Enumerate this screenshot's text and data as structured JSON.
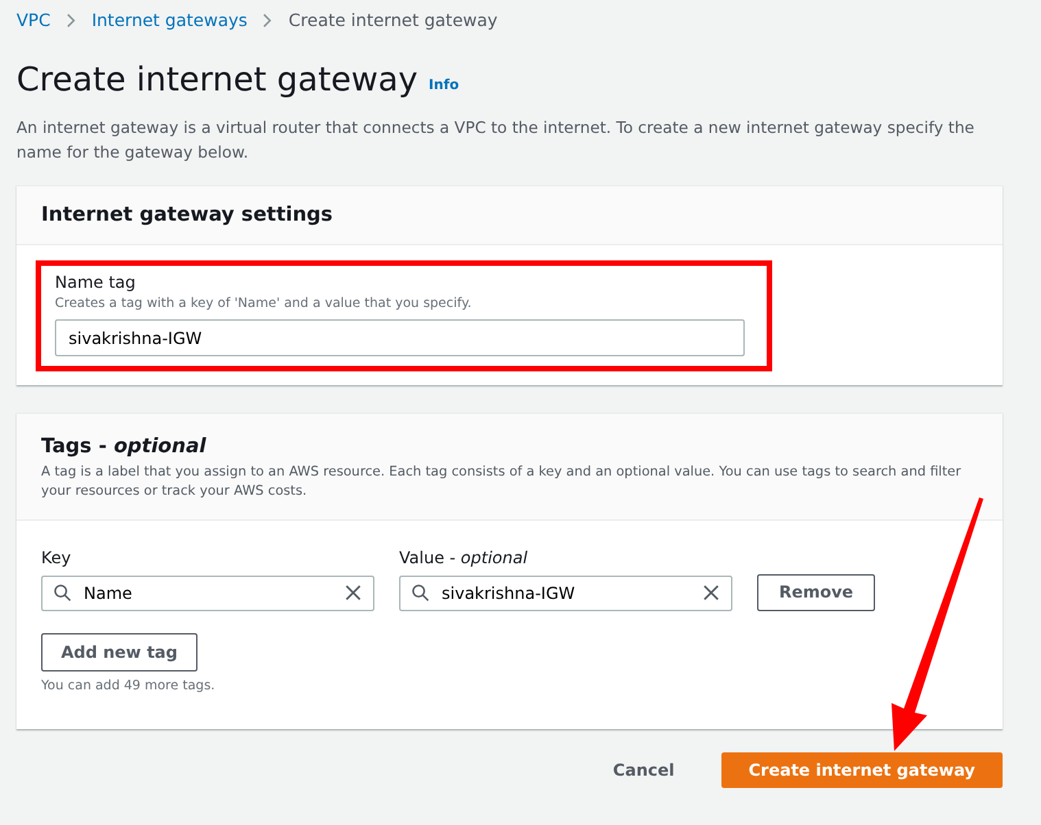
{
  "breadcrumb": [
    {
      "label": "VPC",
      "kind": "link"
    },
    {
      "label": "Internet gateways",
      "kind": "link"
    },
    {
      "label": "Create internet gateway",
      "kind": "current"
    }
  ],
  "title": "Create internet gateway",
  "info_link": "Info",
  "description": "An internet gateway is a virtual router that connects a VPC to the internet. To create a new internet gateway specify the name for the gateway below.",
  "settings": {
    "title": "Internet gateway settings",
    "name_tag": {
      "label": "Name tag",
      "hint": "Creates a tag with a key of 'Name' and a value that you specify.",
      "value": "sivakrishna-IGW"
    }
  },
  "tags": {
    "title": "Tags - ",
    "title_suffix": "optional",
    "description": "A tag is a label that you assign to an AWS resource. Each tag consists of a key and an optional value. You can use tags to search and filter your resources or track your AWS costs.",
    "key_label": "Key",
    "value_label": "Value - ",
    "value_label_suffix": "optional",
    "rows": [
      {
        "key": "Name",
        "value": "sivakrishna-IGW",
        "remove": "Remove"
      }
    ],
    "add_button": "Add new tag",
    "limit_note": "You can add 49 more tags."
  },
  "footer": {
    "cancel": "Cancel",
    "submit": "Create internet gateway"
  }
}
